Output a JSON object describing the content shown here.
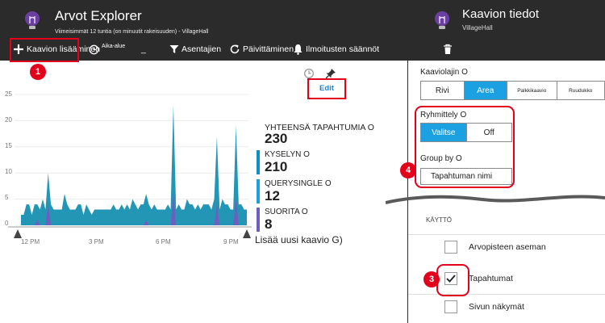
{
  "left_panel": {
    "title": "Arvot Explorer",
    "subtitle": "Viimeisimmät 12 tuntia (on minuutit rakeisuuden) - VillageHall",
    "toolbar": [
      {
        "label": "Kaavion lisääminen",
        "icon": "plus-icon"
      },
      {
        "label": "Aika-alue",
        "icon": "clock-icon"
      },
      {
        "label": "_",
        "icon": ""
      },
      {
        "label": "Asentajien",
        "icon": "filter-icon"
      },
      {
        "label": "Päivittäminen",
        "icon": "refresh-icon"
      },
      {
        "label": "Ilmoitusten säännöt",
        "icon": "bell-icon"
      }
    ],
    "edit_label": "Edit",
    "add_new_chart": "Lisää uusi kaavio G)",
    "legend": [
      {
        "label": "YHTEENSÄ TAPAHTUMIA O",
        "value": "230",
        "color": "#2b2b2b"
      },
      {
        "label": "KYSELYN O",
        "value": "210",
        "color": "#0e8fbd"
      },
      {
        "label": "QUERYSINGLE O",
        "value": "12",
        "color": "#1f9fd9"
      },
      {
        "label": "SUORITA O",
        "value": "8",
        "color": "#6d5ebf"
      }
    ]
  },
  "chart_data": {
    "type": "area",
    "y_ticks": [
      "25",
      "20",
      "15",
      "10",
      "5",
      "0"
    ],
    "x_ticks": [
      "12 PM",
      "3 PM",
      "6 PM",
      "9 PM"
    ],
    "ylim": [
      0,
      25
    ],
    "grid": true,
    "series": [
      {
        "values": [
          2,
          2,
          4,
          4,
          2,
          4,
          4,
          3,
          5,
          3,
          10,
          4,
          3,
          3,
          3,
          3,
          6,
          4,
          3,
          3,
          3,
          4,
          4,
          2,
          4,
          3,
          2,
          3,
          3,
          3,
          3,
          3,
          3,
          3,
          4,
          3,
          3,
          4,
          3,
          4,
          3,
          5,
          4,
          3,
          4,
          4,
          6,
          4,
          3,
          4,
          3,
          3,
          3,
          3,
          4,
          3,
          23,
          3,
          4,
          3,
          3,
          5,
          4,
          4,
          3,
          4,
          3,
          4,
          4,
          4,
          3,
          5,
          17,
          3,
          5,
          4,
          4,
          3,
          3,
          19,
          4,
          4,
          3,
          3
        ]
      },
      {
        "values": [
          0,
          0,
          0,
          0,
          0,
          0,
          1,
          0,
          0,
          0,
          4,
          0,
          0,
          0,
          0,
          0,
          0,
          0,
          0,
          0,
          0,
          0,
          0,
          0,
          0,
          0,
          0,
          0,
          0,
          0,
          0,
          0,
          0,
          0,
          0,
          0,
          0,
          0,
          0,
          0,
          0,
          0,
          0,
          0,
          0,
          0,
          1,
          0,
          0,
          0,
          0,
          0,
          0,
          0,
          0,
          0,
          6,
          0,
          0,
          0,
          0,
          0,
          0,
          0,
          0,
          0,
          0,
          0,
          0,
          0,
          0,
          0,
          4,
          0,
          0,
          0,
          0,
          0,
          0,
          5,
          0,
          0,
          0,
          0
        ]
      }
    ],
    "series_colors": [
      "#2496b5",
      "#6d5ebf"
    ]
  },
  "right_panel": {
    "title": "Kaavion tiedot",
    "subtitle": "VillageHall",
    "chart_type_label": "Kaaviolajin O",
    "chart_types": [
      {
        "label": "Rivi",
        "selected": false
      },
      {
        "label": "Area",
        "selected": true
      },
      {
        "label": "Palkkikaavio",
        "selected": false
      },
      {
        "label": "Ruudukko",
        "selected": false
      }
    ],
    "grouping_label": "Ryhmittely O",
    "grouping_options": [
      {
        "label": "Valitse",
        "selected": true
      },
      {
        "label": "Off",
        "selected": false
      }
    ],
    "group_by_label": "Group by O",
    "group_by_value": "Tapahtuman nimi",
    "usage_header": "KÄYTTÖ",
    "checkboxes": [
      {
        "label": "Arvopisteen aseman",
        "checked": false
      },
      {
        "label": "Tapahtumat",
        "checked": true
      },
      {
        "label": "Sivun näkymät",
        "checked": false
      }
    ]
  },
  "callouts": [
    "1",
    "3",
    "4"
  ],
  "colors": {
    "header_bg": "#2b2b2b",
    "accent": "#1ba1e2",
    "callout": "#e3001b",
    "area": "#2496b5",
    "area2": "#6d5ebf"
  }
}
